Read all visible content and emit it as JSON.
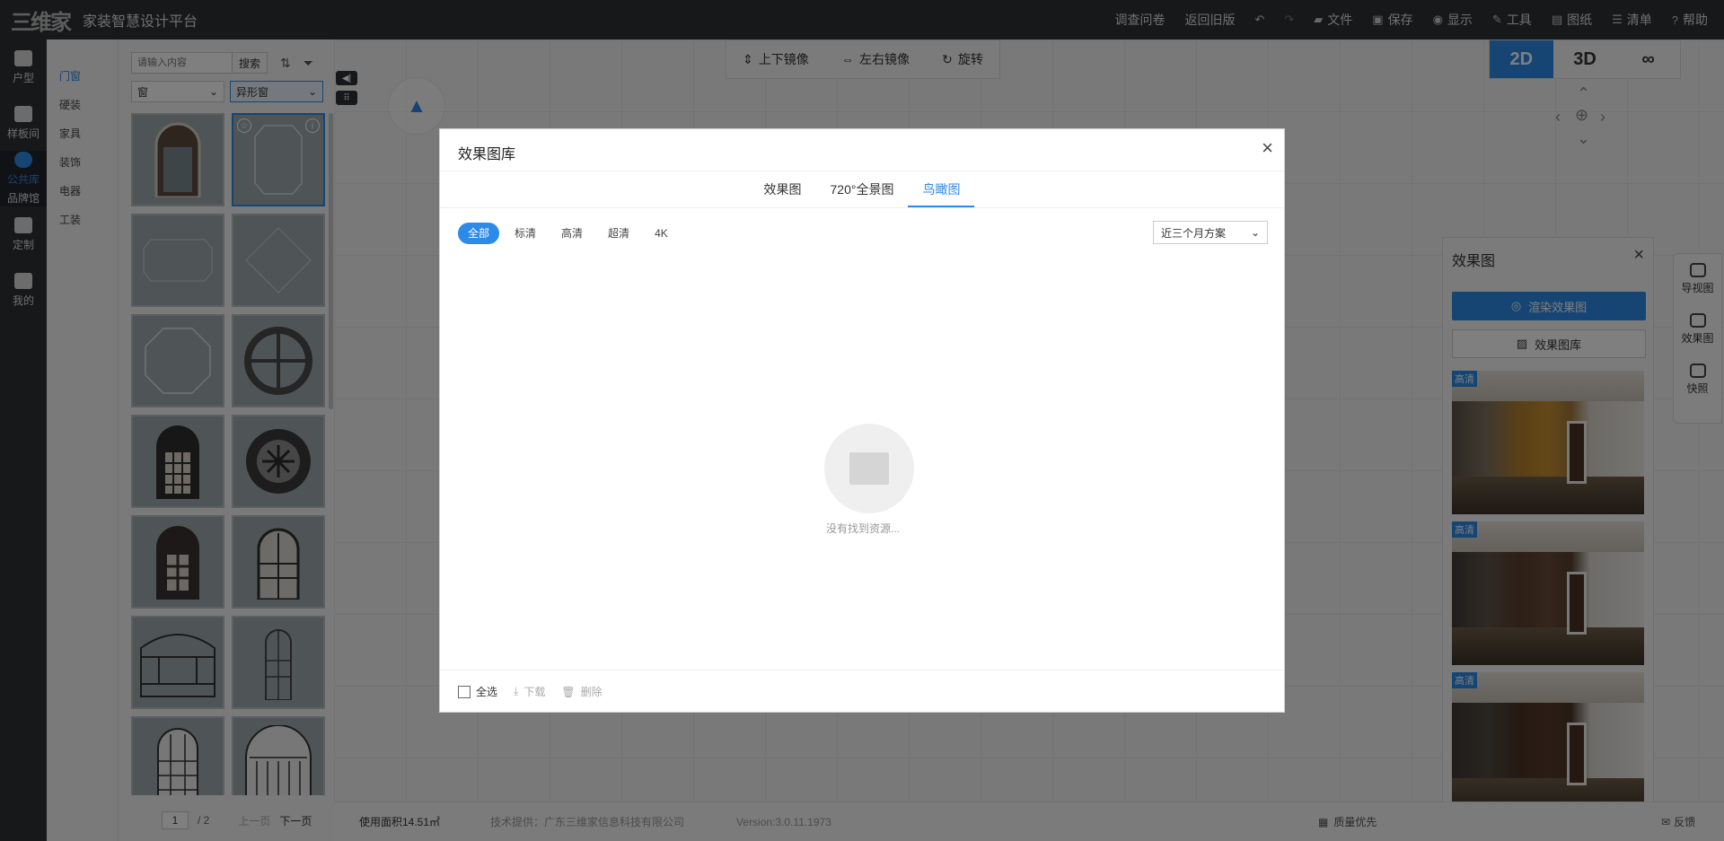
{
  "app": {
    "logo_mark": "三维家",
    "title": "家装智慧设计平台"
  },
  "top_menu": {
    "survey": "调查问卷",
    "old_version": "返回旧版",
    "file": "文件",
    "save": "保存",
    "display": "显示",
    "tools": "工具",
    "drawings": "图纸",
    "list": "清单",
    "help": "帮助"
  },
  "left_nav": [
    {
      "label": "户型"
    },
    {
      "label": "样板间"
    },
    {
      "label": "公共库",
      "sub": "品牌馆"
    },
    {
      "label": "定制"
    },
    {
      "label": "我的"
    }
  ],
  "categories": [
    "门窗",
    "硬装",
    "家具",
    "装饰",
    "电器",
    "工装"
  ],
  "catalog": {
    "search_placeholder": "请输入内容",
    "search_button": "搜索",
    "select_type": "窗",
    "select_subtype": "异形窗",
    "page_current": "1",
    "page_total": "/ 2",
    "prev": "上一页",
    "next": "下一页"
  },
  "toolstrip": {
    "flip_v": "上下镜像",
    "flip_h": "左右镜像",
    "rotate": "旋转"
  },
  "view_toggle": {
    "two_d": "2D",
    "three_d": "3D"
  },
  "right_strip": [
    "导视图",
    "效果图",
    "快照"
  ],
  "render_panel": {
    "title": "效果图",
    "render_button": "渲染效果图",
    "gallery_button": "效果图库",
    "thumbs": [
      {
        "badge": "高清"
      },
      {
        "badge": "高清"
      },
      {
        "badge": "高清"
      }
    ]
  },
  "statusbar": {
    "area": "使用面积14.51㎡",
    "tech": "技术提供：广东三维家信息科技有限公司",
    "version": "Version:3.0.11.1973",
    "quality": "质量优先",
    "feedback": "反馈"
  },
  "modal": {
    "title": "效果图库",
    "tabs": [
      "效果图",
      "720°全景图",
      "鸟瞰图"
    ],
    "active_tab": 2,
    "filters": [
      "全部",
      "标清",
      "高清",
      "超清",
      "4K"
    ],
    "period": "近三个月方案",
    "empty_text": "没有找到资源...",
    "select_all": "全选",
    "download": "下载",
    "delete": "删除"
  }
}
